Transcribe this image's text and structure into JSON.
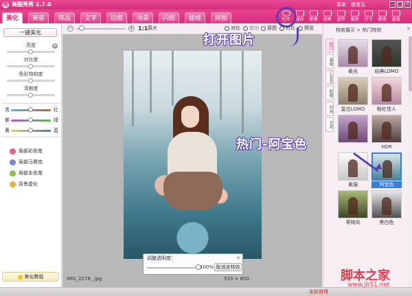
{
  "app": {
    "title": "美图秀秀 2.7.0",
    "logo_glyph": "秀",
    "top_links": [
      "菜单",
      "提意见"
    ],
    "controls": [
      "—",
      "□",
      "✕"
    ]
  },
  "tabs": [
    {
      "label": "美化",
      "active": true
    },
    {
      "label": "美容",
      "active": false
    },
    {
      "label": "饰品",
      "active": false
    },
    {
      "label": "文字",
      "active": false
    },
    {
      "label": "边框",
      "active": false
    },
    {
      "label": "场景",
      "active": false
    },
    {
      "label": "闪图",
      "active": false
    },
    {
      "label": "娃娃",
      "active": false
    },
    {
      "label": "拼图",
      "active": false
    }
  ],
  "toolbar": {
    "open": "打开",
    "save": "保存",
    "new": "新建",
    "cut": "抠图",
    "rotate": "旋转",
    "crop": "裁剪",
    "size": "尺寸",
    "undo": "撤销",
    "redo": "重做"
  },
  "left": {
    "auto_beauty": "一键美化",
    "sliders": [
      {
        "label": "亮度",
        "value": 0.5
      },
      {
        "label": "对比度",
        "value": 0.5
      },
      {
        "label": "色彩饱和度",
        "value": 0.5
      },
      {
        "label": "清晰度",
        "value": 0.5
      }
    ],
    "colors": [
      {
        "left": "青",
        "right": "红",
        "value": 0.5,
        "gradient": "linear-gradient(90deg,#3cc6d8,#e74a4a)"
      },
      {
        "left": "紫",
        "right": "绿",
        "value": 0.5,
        "gradient": "linear-gradient(90deg,#b555d6,#59c04a)"
      },
      {
        "left": "黄",
        "right": "蓝",
        "value": 0.5,
        "gradient": "linear-gradient(90deg,#f0d23a,#4a72d8)"
      }
    ],
    "tools": [
      {
        "label": "局部彩色笔",
        "color": "#e9627d"
      },
      {
        "label": "局部马赛克",
        "color": "#7a8ad0"
      },
      {
        "label": "局部去色笔",
        "color": "#8fc24a"
      },
      {
        "label": "背景虚化",
        "color": "#e6b43a"
      }
    ],
    "tutorial": "美化教程"
  },
  "canvas": {
    "zoom_minus": "−",
    "zoom_plus": "+",
    "zoom_value": 0.05,
    "zoom_ratio": "1:1",
    "original": "原大",
    "controls": [
      "对比",
      "撤销",
      "原图",
      "对比",
      "预览"
    ],
    "adjust_title": "调整透明度：",
    "adjust_close": "✕",
    "adjust_value": 1.0,
    "adjust_percent": "100%",
    "cancel_effect": "取消该特效",
    "file_name": "IMG_2278_.jpg",
    "image_size": "533 × 800"
  },
  "right": {
    "breadcrumb": "特效展示 > 热门特效",
    "close": "✕",
    "side_tabs": [
      "热门",
      "基础",
      "LOMO",
      "影楼",
      "时尚",
      "艺术"
    ],
    "effects": [
      {
        "name": "柔光",
        "thumb": "linear-gradient(#e6dde8,#a88aa8)"
      },
      {
        "name": "经典LOMO",
        "thumb": "linear-gradient(#555,#2a3a2a)"
      },
      {
        "name": "复古LOMO",
        "thumb": "linear-gradient(#d8ceb8,#8e8068)"
      },
      {
        "name": "粉红佳人",
        "thumb": "linear-gradient(#f2d8dc,#b888a0)"
      },
      {
        "name": "",
        "thumb": "linear-gradient(#c2a4c8,#6e4a78)"
      },
      {
        "name": "HDR",
        "thumb": "linear-gradient(#b8a8a0,#504040)"
      },
      {
        "name": "素描",
        "thumb": "linear-gradient(#fafafa,#c8c8c8)"
      },
      {
        "name": "阿宝色",
        "thumb": "linear-gradient(#d8e4e8,#4a8798)",
        "selected": true
      },
      {
        "name": "哥特风",
        "thumb": "linear-gradient(#a8b878,#404828)"
      },
      {
        "name": "黑白色",
        "thumb": "linear-gradient(#e8e8e8,#505050)"
      }
    ],
    "scroll": 0.0
  },
  "status": {
    "weibo": "发新微博"
  },
  "annotations": {
    "open": "打开图片",
    "hot": "热门-阿宝色"
  },
  "watermark": {
    "text": "脚本之家",
    "url": "www.jb51.net"
  },
  "colors": {
    "accent": "#d72e7c",
    "annotation": "#5a3fb2",
    "selected": "#3b7ddb"
  }
}
